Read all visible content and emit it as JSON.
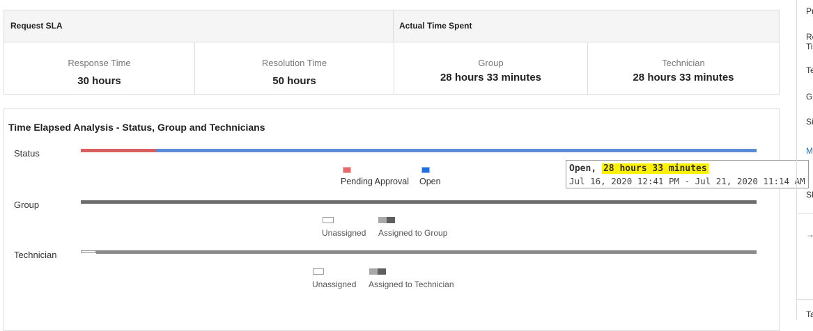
{
  "sla": {
    "request_sla_title": "Request SLA",
    "actual_time_title": "Actual Time Spent",
    "response_time": {
      "label": "Response Time",
      "value": "30 hours"
    },
    "resolution_time": {
      "label": "Resolution Time",
      "value": "50 hours"
    },
    "group": {
      "label": "Group",
      "value": "28 hours 33 minutes"
    },
    "technician": {
      "label": "Technician",
      "value": "28 hours 33 minutes"
    }
  },
  "analysis": {
    "title": "Time Elapsed Analysis - Status, Group and Technicians",
    "status": {
      "label": "Status",
      "legend": [
        {
          "name": "Pending Approval",
          "color": "#e8696b"
        },
        {
          "name": "Open",
          "color": "#1f6fe0"
        }
      ],
      "bar_colors": {
        "pending": "#d9605f",
        "open": "#5b8ad6"
      }
    },
    "group": {
      "label": "Group",
      "legend": [
        {
          "name": "Unassigned"
        },
        {
          "name": "Assigned to Group"
        }
      ]
    },
    "technician": {
      "label": "Technician",
      "legend": [
        {
          "name": "Unassigned"
        },
        {
          "name": "Assigned to Technician"
        }
      ]
    }
  },
  "tooltip": {
    "status": "Open",
    "duration": "28 hours 33 minutes",
    "range": "Jul 16, 2020 12:41 PM - Jul 21, 2020 11:14 AM"
  },
  "sidebar": {
    "items": [
      "Pr",
      "Re",
      "Ti",
      "Te",
      "Gr",
      "Si",
      "M",
      "Sh",
      "→",
      "Ta"
    ]
  }
}
